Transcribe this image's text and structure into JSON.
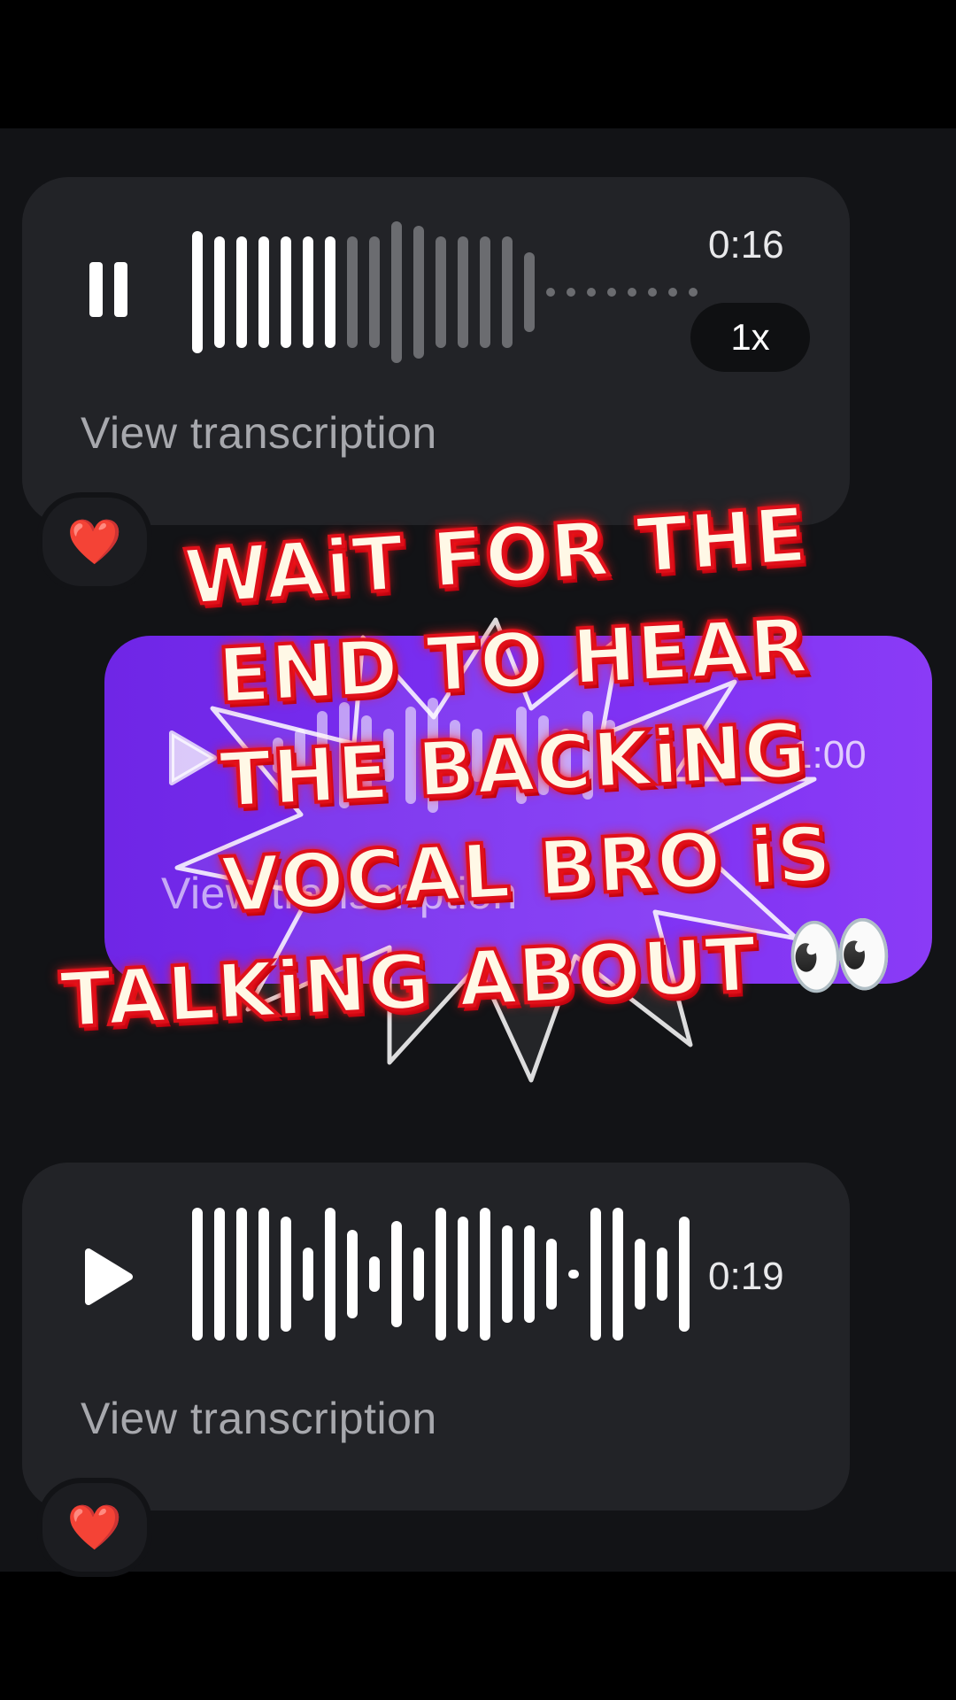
{
  "messages": [
    {
      "state": "playing",
      "duration": "0:16",
      "speed": "1x",
      "transcription_link": "View transcription",
      "reaction": "❤️",
      "progress": 0.45
    },
    {
      "state": "paused",
      "duration": "1:00",
      "transcription_link": "View transcription",
      "bubble_color": "#7b2ff2"
    },
    {
      "state": "paused",
      "duration": "0:19",
      "transcription_link": "View transcription",
      "reaction": "❤️"
    }
  ],
  "overlay": {
    "line1": "WAiT FOR THE",
    "line2": "END TO HEAR",
    "line3": "THE BACKiNG",
    "line4": "VOCAL BRO iS",
    "line5": "TALKiNG ABOUT",
    "emoji": "👀",
    "text_color": "#fff8e6",
    "outline_color": "#e0101a"
  },
  "colors": {
    "background": "#121316",
    "bubble": "#222327",
    "accent_purple": "#7b2ff2"
  }
}
